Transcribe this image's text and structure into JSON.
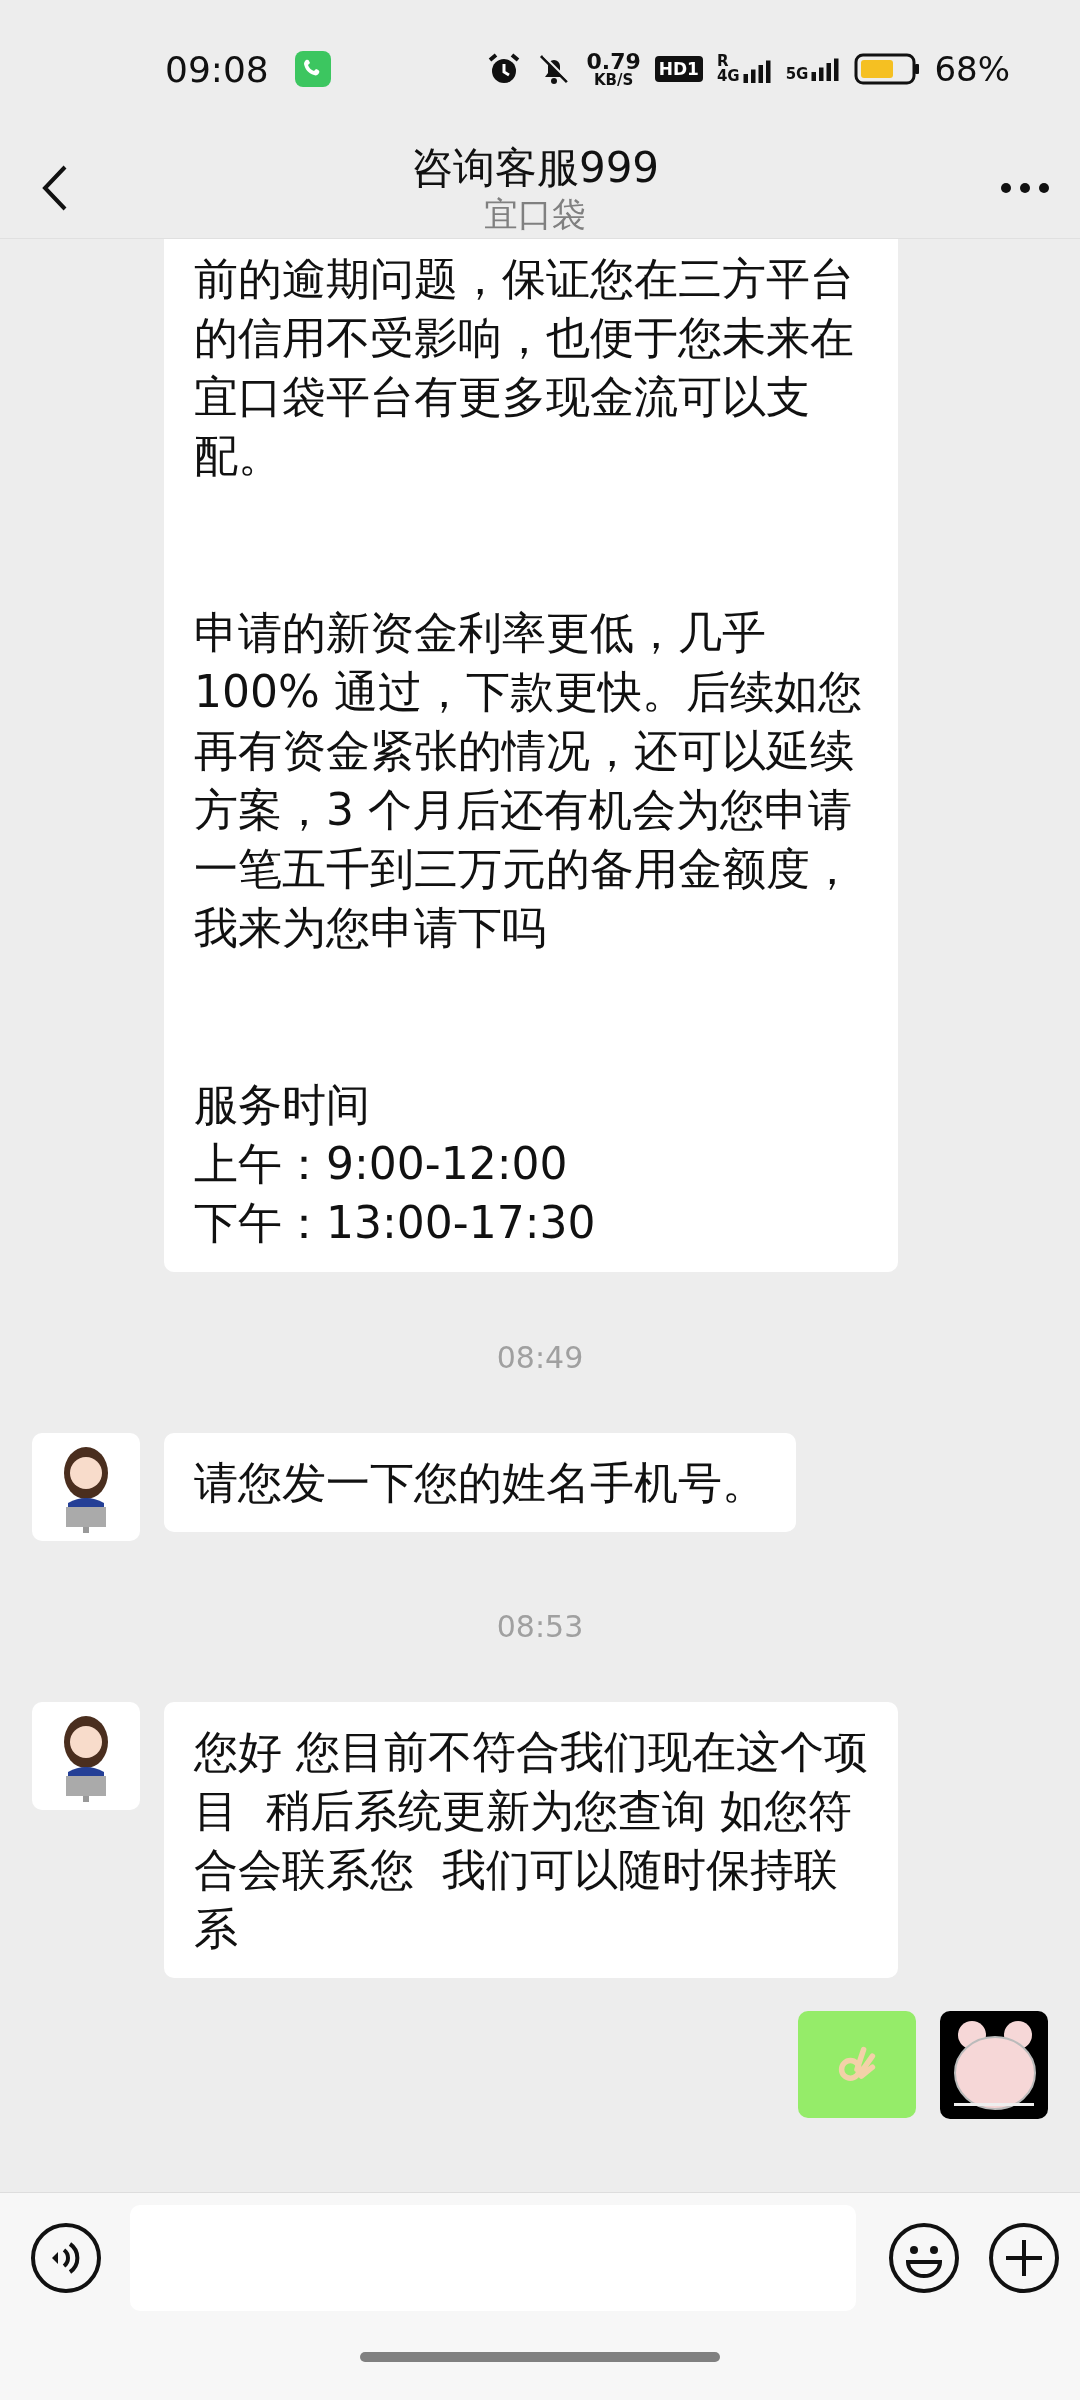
{
  "status_bar": {
    "time": "09:08",
    "speed_value": "0.79",
    "speed_unit": "KB/S",
    "hd_badge": "HD1",
    "roaming_label": "R",
    "sim1_label": "4G",
    "sim2_label": "5G",
    "battery": "68%"
  },
  "header": {
    "title": "咨询客服999",
    "subtitle": "宜口袋"
  },
  "messages": [
    {
      "kind": "incoming_text",
      "avatar_shown": false,
      "paragraphs": [
        [
          "前的逾期问题，保证您在三方平台的信用不受影响，也便于您未来在宜口袋平台有更多现金流可以支配。"
        ],
        [
          "申请的新资金利率更低，几乎100% 通过，下款更快。后续如您再有资金紧张的情况，还可以延续方案，3 个月后还有机会为您申请一笔五千到三万元的备用金额度，我来为您申请下吗"
        ],
        [
          "服务时间",
          "上午：9:00-12:00",
          "下午：13:00-17:30"
        ]
      ]
    },
    {
      "kind": "time",
      "text": "08:49"
    },
    {
      "kind": "incoming_text",
      "avatar_shown": true,
      "paragraphs": [
        [
          "请您发一下您的姓名手机号。"
        ]
      ]
    },
    {
      "kind": "time",
      "text": "08:53"
    },
    {
      "kind": "incoming_text",
      "avatar_shown": true,
      "paragraphs": [
        [
          "您好 您目前不符合我们现在这个项目  稍后系统更新为您查询 如您符合会联系您  我们可以随时保持联系"
        ]
      ]
    },
    {
      "kind": "outgoing_emoji",
      "avatar_shown": true
    }
  ]
}
